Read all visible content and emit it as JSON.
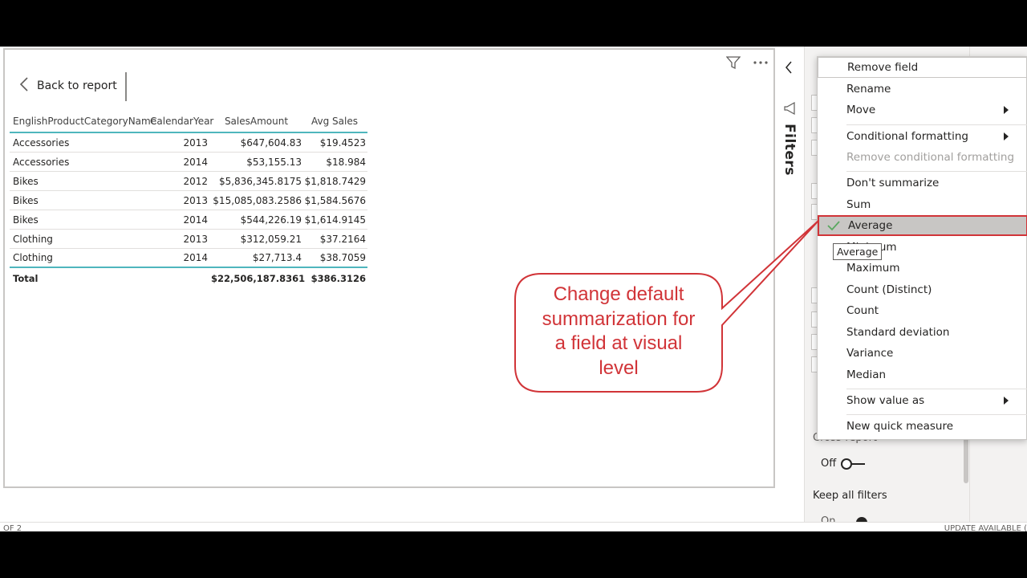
{
  "report": {
    "back_label": "Back to report"
  },
  "table": {
    "headers": [
      "EnglishProductCategoryName",
      "CalendarYear",
      "SalesAmount",
      "Avg Sales"
    ],
    "rows": [
      [
        "Accessories",
        "2013",
        "$647,604.83",
        "$19.4523"
      ],
      [
        "Accessories",
        "2014",
        "$53,155.13",
        "$18.984"
      ],
      [
        "Bikes",
        "2012",
        "$5,836,345.8175",
        "$1,818.7429"
      ],
      [
        "Bikes",
        "2013",
        "$15,085,083.2586",
        "$1,584.5676"
      ],
      [
        "Bikes",
        "2014",
        "$544,226.19",
        "$1,614.9145"
      ],
      [
        "Clothing",
        "2013",
        "$312,059.21",
        "$37.2164"
      ],
      [
        "Clothing",
        "2014",
        "$27,713.4",
        "$38.7059"
      ]
    ],
    "total": {
      "label": "Total",
      "sales": "$22,506,187.8361",
      "avg": "$386.3126"
    }
  },
  "filters_pane": {
    "label": "Filters"
  },
  "viz_pane": {
    "cross_report_label": "Cross-report",
    "off_label": "Off",
    "keep_all_filters_label": "Keep all filters",
    "on_label": "On"
  },
  "status": {
    "left": "OF 2",
    "right": "UPDATE AVAILABLE ("
  },
  "context_menu": {
    "items": [
      {
        "label": "Remove field"
      },
      {
        "label": "Rename"
      },
      {
        "label": "Move"
      },
      {
        "label": "Conditional formatting"
      },
      {
        "label": "Remove conditional formatting"
      },
      {
        "label": "Don't summarize"
      },
      {
        "label": "Sum"
      },
      {
        "label": "Average"
      },
      {
        "label": "Minimum"
      },
      {
        "label": "Maximum"
      },
      {
        "label": "Count (Distinct)"
      },
      {
        "label": "Count"
      },
      {
        "label": "Standard deviation"
      },
      {
        "label": "Variance"
      },
      {
        "label": "Median"
      },
      {
        "label": "Show value as"
      },
      {
        "label": "New quick measure"
      }
    ]
  },
  "tooltip": {
    "text": "Average"
  },
  "callout": {
    "line1": "Change default",
    "line2": "summarization for",
    "line3": "a field at visual",
    "line4": "level"
  },
  "colors": {
    "accent_teal": "#4fb6bd",
    "callout_red": "#d13438",
    "check_green": "#5aa860"
  }
}
